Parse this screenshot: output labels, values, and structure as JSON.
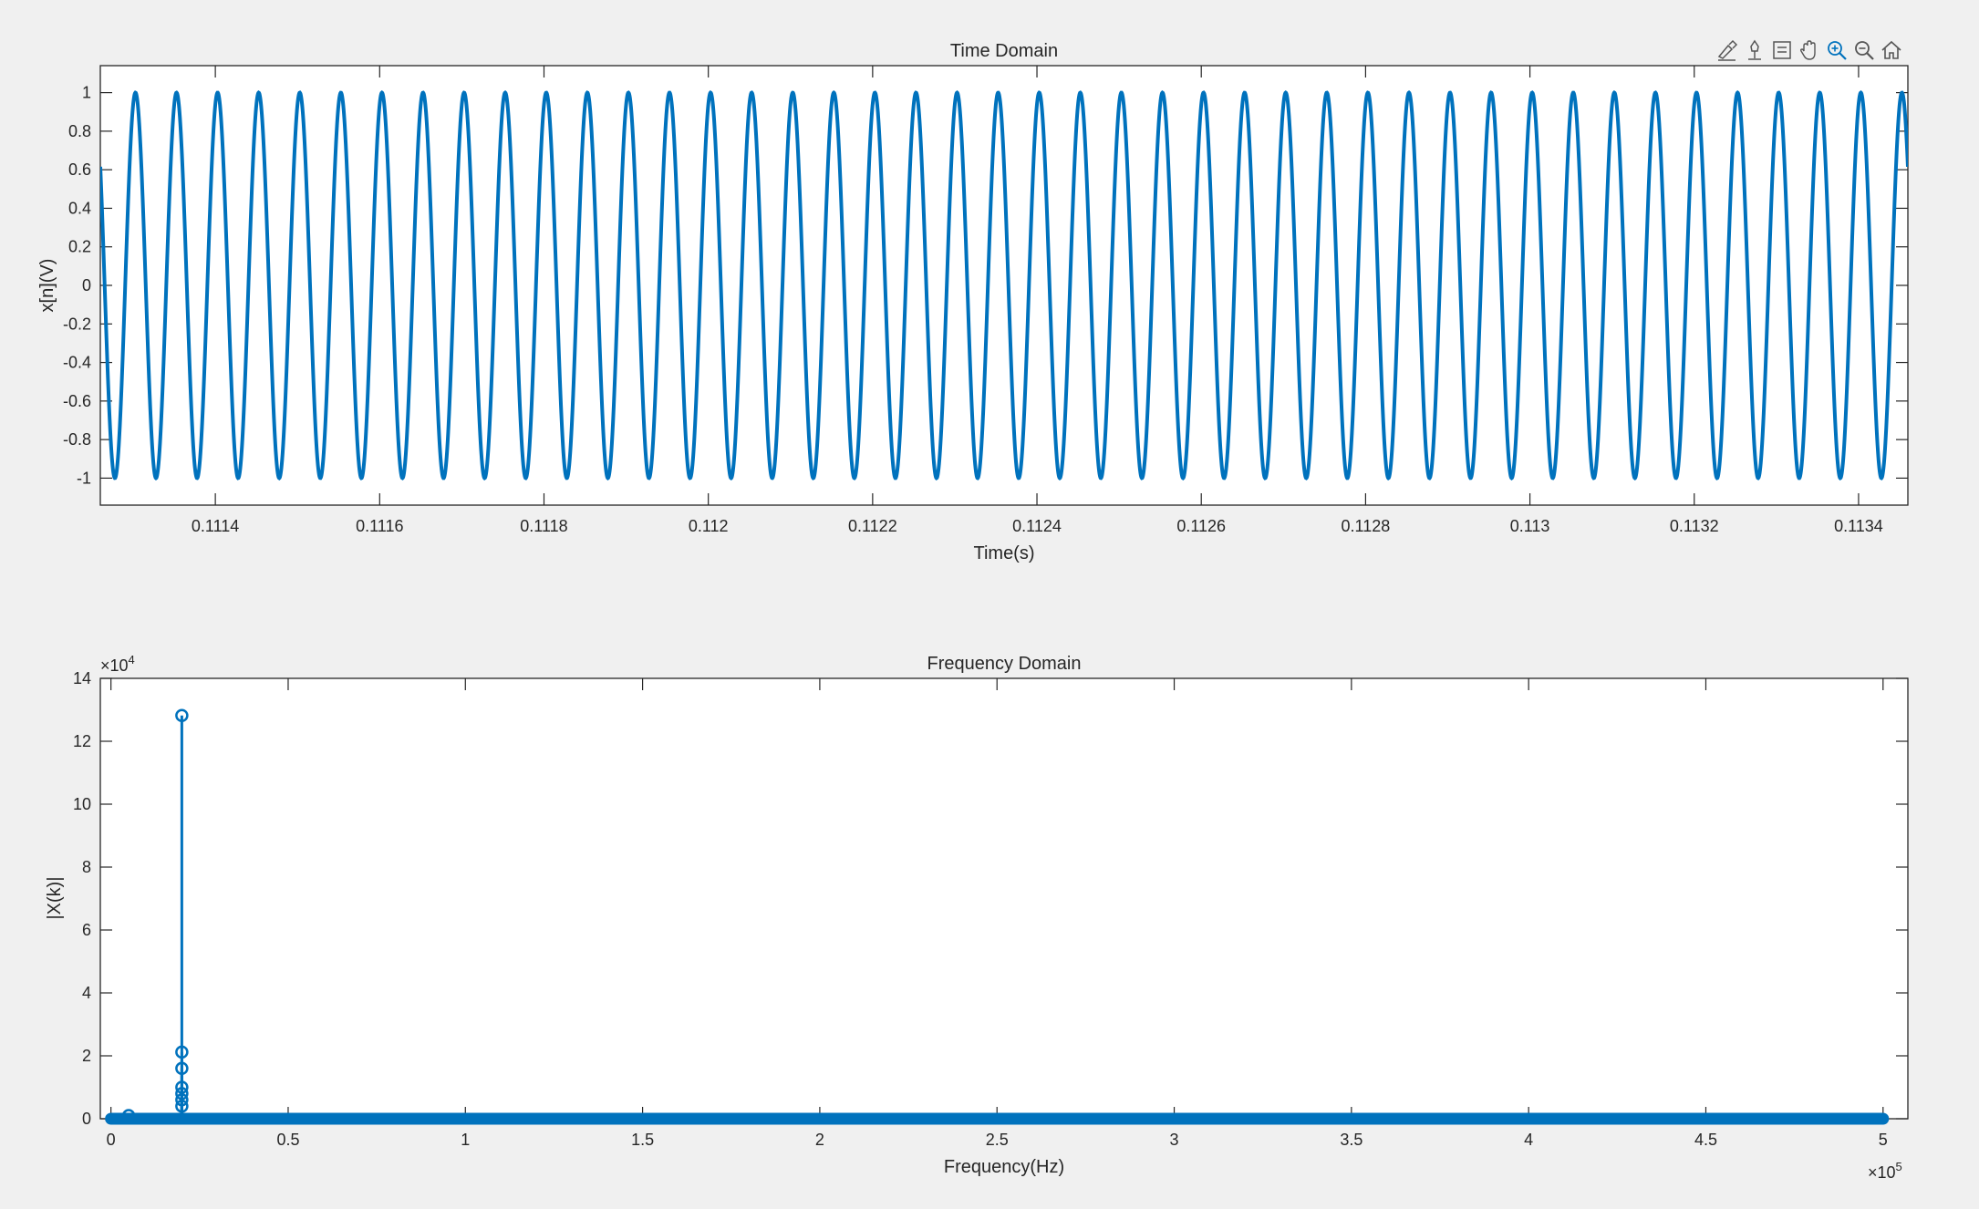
{
  "toolbar": {
    "icons": [
      "brush-icon",
      "pin-icon",
      "legend-icon",
      "pan-icon",
      "zoom-in-icon",
      "zoom-out-icon",
      "home-icon"
    ]
  },
  "colors": {
    "series": "#0072bd",
    "axes": "#262626",
    "background": "#f0f0f0",
    "plot": "#ffffff"
  },
  "chart_data": [
    {
      "type": "line",
      "title": "Time Domain",
      "xlabel": "Time(s)",
      "ylabel": "x[n](V)",
      "xlim": [
        0.11126,
        0.11346
      ],
      "ylim": [
        -1.14,
        1.14
      ],
      "xticks": [
        0.1114,
        0.1116,
        0.1118,
        0.112,
        0.1122,
        0.1124,
        0.1126,
        0.1128,
        0.113,
        0.1132,
        0.1134
      ],
      "xtick_labels": [
        "0.1114",
        "0.1116",
        "0.1118",
        "0.112",
        "0.1122",
        "0.1124",
        "0.1126",
        "0.1128",
        "0.113",
        "0.1132",
        "0.1134"
      ],
      "yticks": [
        -1,
        -0.8,
        -0.6,
        -0.4,
        -0.2,
        0,
        0.2,
        0.4,
        0.6,
        0.8,
        1
      ],
      "ytick_labels": [
        "-1",
        "-0.8",
        "-0.6",
        "-0.4",
        "-0.2",
        "0",
        "0.2",
        "0.4",
        "0.6",
        "0.8",
        "1"
      ],
      "signal": {
        "shape": "sine",
        "amplitude": 1.0,
        "frequency_hz": 20000,
        "phase_deg": 70
      },
      "grid": false
    },
    {
      "type": "stem",
      "title": "Frequency Domain",
      "xlabel": "Frequency(Hz)",
      "ylabel": "|X(k)|",
      "xlim": [
        -3000,
        507000
      ],
      "ylim": [
        0,
        140000
      ],
      "xticks": [
        0,
        50000,
        100000,
        150000,
        200000,
        250000,
        300000,
        350000,
        400000,
        450000,
        500000
      ],
      "xtick_labels": [
        "0",
        "0.5",
        "1",
        "1.5",
        "2",
        "2.5",
        "3",
        "3.5",
        "4",
        "4.5",
        "5"
      ],
      "x_exponent": "×10",
      "x_exponent_power": "5",
      "yticks": [
        0,
        20000,
        40000,
        60000,
        80000,
        100000,
        120000,
        140000
      ],
      "ytick_labels": [
        "0",
        "2",
        "4",
        "6",
        "8",
        "10",
        "12",
        "14"
      ],
      "y_exponent": "×10",
      "y_exponent_power": "4",
      "stems": [
        {
          "x": 20000,
          "y": 128200
        },
        {
          "x": 20000,
          "y": 21200
        },
        {
          "x": 20000,
          "y": 16000
        },
        {
          "x": 20000,
          "y": 10000
        },
        {
          "x": 20000,
          "y": 8000
        },
        {
          "x": 20000,
          "y": 6000
        },
        {
          "x": 20000,
          "y": 4000
        },
        {
          "x": 5000,
          "y": 1000
        }
      ],
      "noise_floor": {
        "from": 0,
        "to": 500000,
        "level": 0
      },
      "grid": false
    }
  ]
}
